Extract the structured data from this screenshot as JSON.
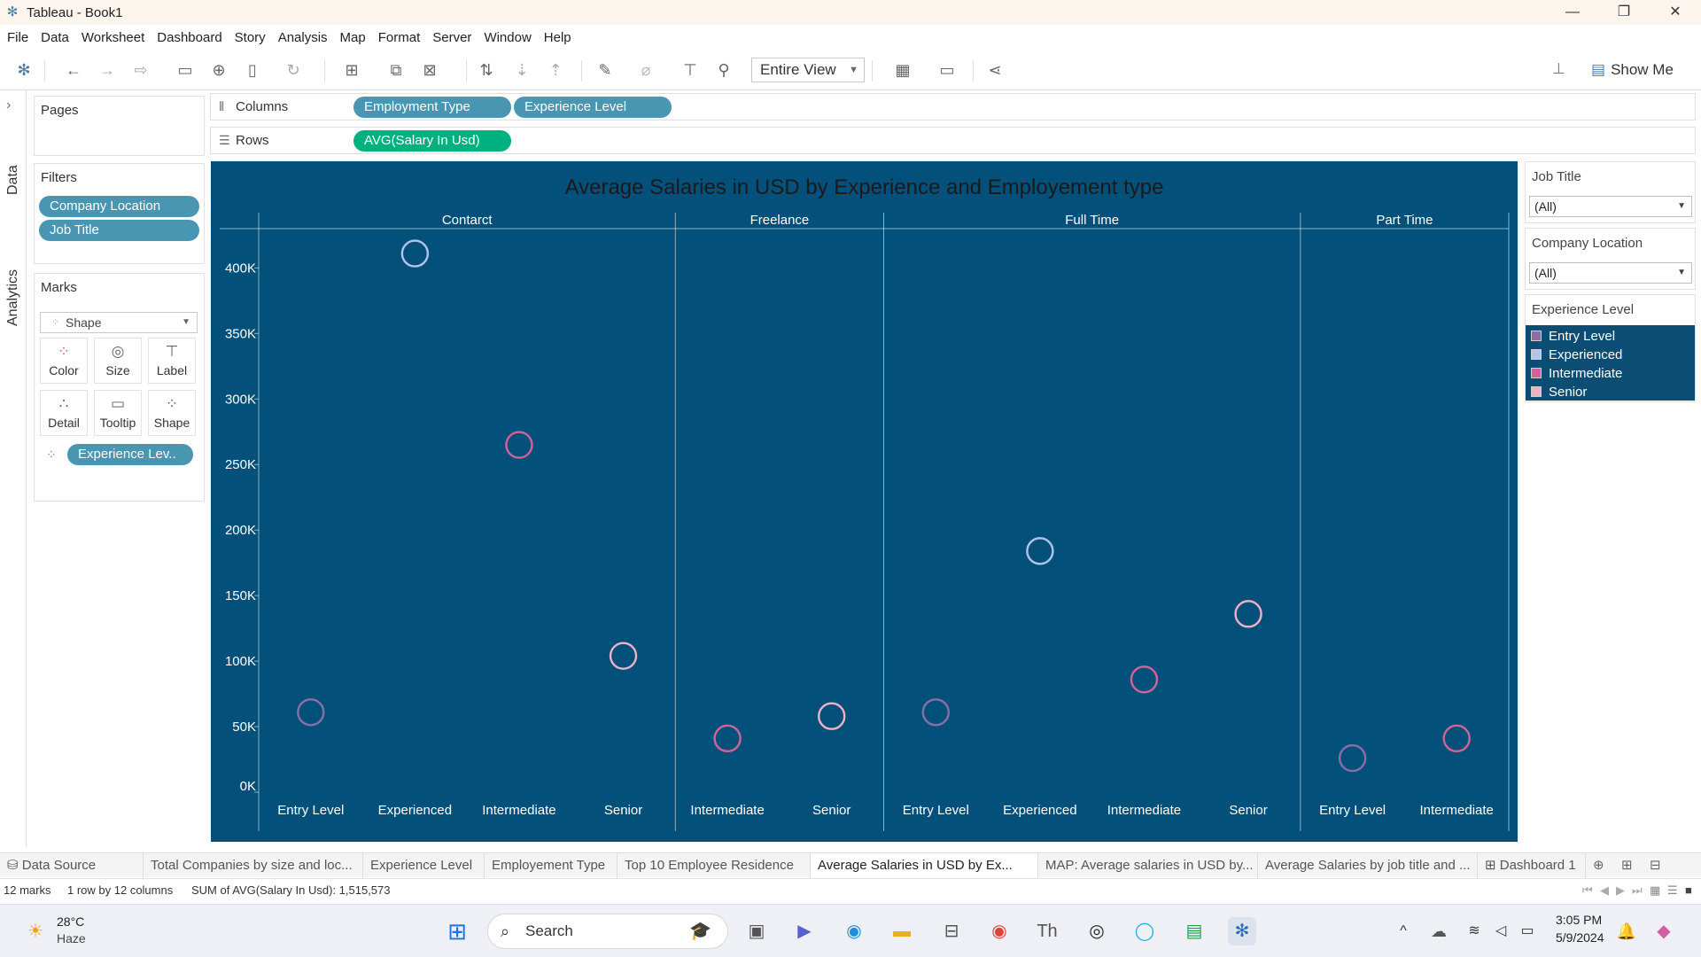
{
  "window": {
    "title": "Tableau - Book1",
    "controls": [
      "—",
      "❐",
      "✕"
    ]
  },
  "menu": [
    "File",
    "Data",
    "Worksheet",
    "Dashboard",
    "Story",
    "Analysis",
    "Map",
    "Format",
    "Server",
    "Window",
    "Help"
  ],
  "toolbar": {
    "fit_value": "Entire View",
    "show_me": "Show Me"
  },
  "side_tabs": {
    "data": "Data",
    "analytics": "Analytics"
  },
  "panels": {
    "pages_title": "Pages",
    "filters_title": "Filters",
    "filters": [
      "Company Location",
      "Job Title"
    ],
    "marks_title": "Marks",
    "mark_type": "Shape",
    "mark_buttons": [
      "Color",
      "Size",
      "Label",
      "Detail",
      "Tooltip",
      "Shape"
    ],
    "color_pill": "Experience Lev.."
  },
  "shelves": {
    "columns_label": "Columns",
    "columns": [
      "Employment Type",
      "Experience Level"
    ],
    "rows_label": "Rows",
    "rows": [
      "AVG(Salary In Usd)"
    ]
  },
  "right_panel": {
    "job_title": {
      "title": "Job Title",
      "value": "(All)"
    },
    "company_location": {
      "title": "Company Location",
      "value": "(All)"
    },
    "legend_title": "Experience Level",
    "legend": [
      {
        "label": "Entry Level",
        "color": "#8a6fa4"
      },
      {
        "label": "Experienced",
        "color": "#b3c3ec"
      },
      {
        "label": "Intermediate",
        "color": "#d06497"
      },
      {
        "label": "Senior",
        "color": "#eeb2c5"
      }
    ]
  },
  "sheet_tabs": [
    "Data Source",
    "Total Companies by size and loc...",
    "Experience Level",
    "Employement Type",
    "Top 10 Employee Residence",
    "Average Salaries in USD by Ex...",
    "MAP: Average salaries in USD by...",
    "Average Salaries by job title and ...",
    "Dashboard 1"
  ],
  "active_tab": "Average Salaries in USD by Ex...",
  "status": {
    "marks": "12 marks",
    "dims": "1 row by 12 columns",
    "sum": "SUM of AVG(Salary In Usd): 1,515,573"
  },
  "taskbar": {
    "temp": "28°C",
    "weather": "Haze",
    "search": "Search",
    "time": "3:05 PM",
    "date": "5/9/2024"
  },
  "chart_data": {
    "type": "scatter",
    "title": "Average Salaries in USD by Experience and Employement type",
    "ylabel": "",
    "ylim": [
      0,
      430000
    ],
    "yticks": [
      0,
      50000,
      100000,
      150000,
      200000,
      250000,
      300000,
      350000,
      400000
    ],
    "ytick_labels": [
      "0K",
      "50K",
      "100K",
      "150K",
      "200K",
      "250K",
      "300K",
      "350K",
      "400K"
    ],
    "panes": [
      {
        "name": "Contarct",
        "categories": [
          "Entry Level",
          "Experienced",
          "Intermediate",
          "Senior"
        ],
        "values": [
          61000,
          411000,
          265000,
          104000
        ]
      },
      {
        "name": "Freelance",
        "categories": [
          "Intermediate",
          "Senior"
        ],
        "values": [
          41000,
          58000
        ]
      },
      {
        "name": "Full Time",
        "categories": [
          "Entry Level",
          "Experienced",
          "Intermediate",
          "Senior"
        ],
        "values": [
          61000,
          184000,
          86000,
          136000
        ]
      },
      {
        "name": "Part Time",
        "categories": [
          "Entry Level",
          "Intermediate"
        ],
        "values": [
          26000,
          41000
        ]
      }
    ],
    "colors": {
      "Entry Level": "#8a6fa4",
      "Experienced": "#b3c3ec",
      "Intermediate": "#d06497",
      "Senior": "#eeb2c5"
    },
    "background": "#03507b",
    "grid": false,
    "legend": "right"
  }
}
